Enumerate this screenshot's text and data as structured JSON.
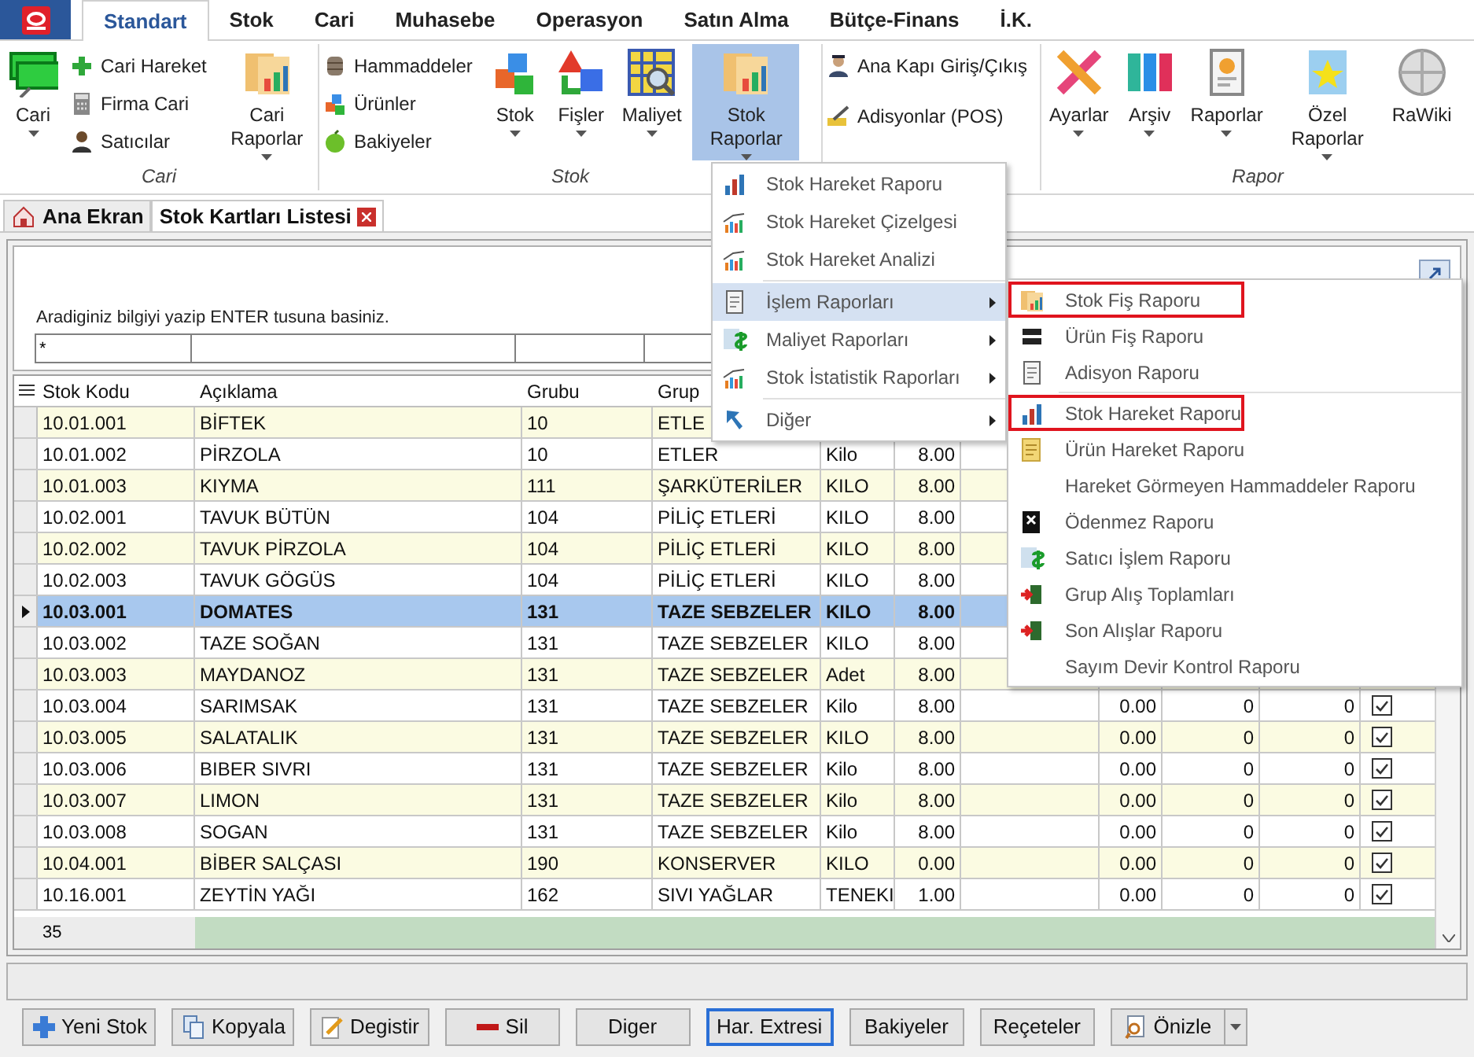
{
  "ribbon": {
    "tabs": [
      {
        "label": "Standart",
        "selected": true
      },
      {
        "label": "Stok",
        "selected": false
      },
      {
        "label": "Cari",
        "selected": false
      },
      {
        "label": "Muhasebe",
        "selected": false
      },
      {
        "label": "Operasyon",
        "selected": false
      },
      {
        "label": "Satın Alma",
        "selected": false
      },
      {
        "label": "Bütçe-Finans",
        "selected": false
      },
      {
        "label": "İ.K.",
        "selected": false
      }
    ],
    "groups": [
      {
        "label": "Cari",
        "items": [
          {
            "kind": "large",
            "label": "Cari",
            "dropdown": true,
            "selected": false
          },
          {
            "kind": "stack",
            "items": [
              {
                "label": "Cari Hareket"
              },
              {
                "label": "Firma Cari"
              },
              {
                "label": "Satıcılar"
              }
            ]
          },
          {
            "kind": "large",
            "label": "Cari Raporlar",
            "dropdown": true,
            "selected": false
          }
        ]
      },
      {
        "label": "Stok",
        "items": [
          {
            "kind": "stack",
            "items": [
              {
                "label": "Hammaddeler"
              },
              {
                "label": "Ürünler"
              },
              {
                "label": "Bakiyeler"
              }
            ]
          },
          {
            "kind": "large",
            "label": "Stok",
            "dropdown": true,
            "selected": false
          },
          {
            "kind": "large",
            "label": "Fişler",
            "dropdown": true,
            "selected": false
          },
          {
            "kind": "large",
            "label": "Maliyet",
            "dropdown": true,
            "selected": false
          },
          {
            "kind": "large",
            "label": "Stok Raporlar",
            "dropdown": true,
            "selected": true
          }
        ]
      },
      {
        "items": [
          {
            "kind": "stack",
            "items": [
              {
                "label": "Ana Kapı Giriş/Çıkış"
              },
              {
                "label": "Adisyonlar (POS)"
              }
            ]
          }
        ]
      },
      {
        "label": "Rapor",
        "items": [
          {
            "kind": "large",
            "label": "Ayarlar",
            "dropdown": true,
            "selected": false
          },
          {
            "kind": "large",
            "label": "Arşiv",
            "dropdown": true,
            "selected": false
          },
          {
            "kind": "large",
            "label": "Raporlar",
            "dropdown": true,
            "selected": false
          },
          {
            "kind": "large",
            "label": "Özel Raporlar",
            "dropdown": true,
            "selected": false
          },
          {
            "kind": "large",
            "label": "RaWiki",
            "dropdown": false,
            "selected": false
          }
        ]
      }
    ]
  },
  "document_tabs": [
    {
      "label": "Ana Ekran",
      "selected": false,
      "closable": false
    },
    {
      "label": "Stok Kartları Listesi",
      "selected": true,
      "closable": true
    }
  ],
  "filter": {
    "hint": "Aradiginiz bilgiyi yazip ENTER tusuna basiniz.",
    "fields": [
      "*"
    ]
  },
  "grid": {
    "columns": [
      "Stok Kodu",
      "Açıklama",
      "Grubu",
      "Grup"
    ],
    "rows": [
      {
        "selected": false,
        "stock_code": "10.01.001",
        "description": "BİFTEK",
        "group_code": "10",
        "group_name": "ETLE"
      },
      {
        "selected": false,
        "stock_code": "10.01.002",
        "description": "PİRZOLA",
        "group_code": "10",
        "group_name": "ETLER",
        "unit": "Kilo",
        "quantity": "8.00"
      },
      {
        "selected": false,
        "stock_code": "10.01.003",
        "description": "KIYMA",
        "group_code": "111",
        "group_name": "ŞARKÜTERİLER",
        "unit": "KILO",
        "quantity": "8.00"
      },
      {
        "selected": false,
        "stock_code": "10.02.001",
        "description": "TAVUK BÜTÜN",
        "group_code": "104",
        "group_name": "PİLİÇ ETLERİ",
        "unit": "KILO",
        "quantity": "8.00"
      },
      {
        "selected": false,
        "stock_code": "10.02.002",
        "description": "TAVUK PİRZOLA",
        "group_code": "104",
        "group_name": "PİLİÇ ETLERİ",
        "unit": "KILO",
        "quantity": "8.00"
      },
      {
        "selected": false,
        "stock_code": "10.02.003",
        "description": "TAVUK GÖGÜS",
        "group_code": "104",
        "group_name": "PİLİÇ ETLERİ",
        "unit": "KILO",
        "quantity": "8.00"
      },
      {
        "selected": true,
        "stock_code": "10.03.001",
        "description": "DOMATES",
        "group_code": "131",
        "group_name": "TAZE SEBZELER",
        "unit": "KILO",
        "quantity": "8.00"
      },
      {
        "selected": false,
        "stock_code": "10.03.002",
        "description": "TAZE SOĞAN",
        "group_code": "131",
        "group_name": "TAZE SEBZELER",
        "unit": "KILO",
        "quantity": "8.00"
      },
      {
        "selected": false,
        "stock_code": "10.03.003",
        "description": "MAYDANOZ",
        "group_code": "131",
        "group_name": "TAZE SEBZELER",
        "unit": "Adet",
        "quantity": "8.00"
      },
      {
        "selected": false,
        "stock_code": "10.03.004",
        "description": "SARIMSAK",
        "group_code": "131",
        "group_name": "TAZE SEBZELER",
        "unit": "Kilo",
        "quantity": "8.00",
        "column_8": "0.00",
        "column_9": "0",
        "column_10": "0",
        "checked": true
      },
      {
        "selected": false,
        "stock_code": "10.03.005",
        "description": "SALATALIK",
        "group_code": "131",
        "group_name": "TAZE SEBZELER",
        "unit": "KILO",
        "quantity": "8.00",
        "column_8": "0.00",
        "column_9": "0",
        "column_10": "0",
        "checked": true
      },
      {
        "selected": false,
        "stock_code": "10.03.006",
        "description": "BIBER SIVRI",
        "group_code": "131",
        "group_name": "TAZE SEBZELER",
        "unit": "Kilo",
        "quantity": "8.00",
        "column_8": "0.00",
        "column_9": "0",
        "column_10": "0",
        "checked": true
      },
      {
        "selected": false,
        "stock_code": "10.03.007",
        "description": "LIMON",
        "group_code": "131",
        "group_name": "TAZE SEBZELER",
        "unit": "Kilo",
        "quantity": "8.00",
        "column_8": "0.00",
        "column_9": "0",
        "column_10": "0",
        "checked": true
      },
      {
        "selected": false,
        "stock_code": "10.03.008",
        "description": "SOGAN",
        "group_code": "131",
        "group_name": "TAZE SEBZELER",
        "unit": "Kilo",
        "quantity": "8.00",
        "column_8": "0.00",
        "column_9": "0",
        "column_10": "0",
        "checked": true
      },
      {
        "selected": false,
        "stock_code": "10.04.001",
        "description": "BİBER SALÇASI",
        "group_code": "190",
        "group_name": "KONSERVER",
        "unit": "KILO",
        "quantity": "0.00",
        "column_8": "0.00",
        "column_9": "0",
        "column_10": "0",
        "checked": true
      },
      {
        "selected": false,
        "stock_code": "10.16.001",
        "description": "ZEYTİN YAĞI",
        "group_code": "162",
        "group_name": "SIVI YAĞLAR",
        "unit": "TENEKI",
        "quantity": "1.00",
        "column_8": "0.00",
        "column_9": "0",
        "column_10": "0",
        "checked": true
      }
    ],
    "footer_count": "35"
  },
  "menu": {
    "items": [
      {
        "kind": "item",
        "label": "Stok Hareket Raporu",
        "selected": false,
        "separator_before": false
      },
      {
        "kind": "item",
        "label": "Stok Hareket Çizelgesi",
        "selected": false,
        "separator_before": false
      },
      {
        "kind": "item",
        "label": "Stok Hareket Analizi",
        "selected": false,
        "separator_before": false
      },
      {
        "kind": "submenu",
        "label": "İşlem Raporları",
        "selected": true,
        "separator_before": true
      },
      {
        "kind": "submenu",
        "label": "Maliyet Raporları",
        "selected": false,
        "separator_before": false
      },
      {
        "kind": "submenu",
        "label": "Stok İstatistik Raporları",
        "selected": false,
        "separator_before": false
      },
      {
        "kind": "submenu",
        "label": "Diğer",
        "selected": false,
        "separator_before": true
      }
    ]
  },
  "submenu": {
    "items": [
      {
        "label": "Stok Fiş Raporu",
        "highlighted": true,
        "separator_before": false
      },
      {
        "label": "Ürün Fiş Raporu",
        "highlighted": false,
        "separator_before": false
      },
      {
        "label": "Adisyon Raporu",
        "highlighted": false,
        "separator_before": false
      },
      {
        "label": "Stok Hareket Raporu",
        "highlighted": true,
        "separator_before": true
      },
      {
        "label": "Ürün Hareket Raporu",
        "highlighted": false,
        "separator_before": false
      },
      {
        "label": "Hareket Görmeyen Hammaddeler Raporu",
        "highlighted": false,
        "separator_before": false
      },
      {
        "label": "Ödenmez Raporu",
        "highlighted": false,
        "separator_before": false
      },
      {
        "label": "Satıcı İşlem Raporu",
        "highlighted": false,
        "separator_before": false
      },
      {
        "label": "Grup Alış Toplamları",
        "highlighted": false,
        "separator_before": false
      },
      {
        "label": "Son Alışlar Raporu",
        "highlighted": false,
        "separator_before": false
      },
      {
        "label": "Sayım Devir Kontrol Raporu",
        "highlighted": false,
        "separator_before": false
      }
    ]
  },
  "buttons": [
    {
      "label": "Yeni Stok",
      "focused": false,
      "dropdown": false
    },
    {
      "label": "Kopyala",
      "focused": false,
      "dropdown": false
    },
    {
      "label": "Degistir",
      "focused": false,
      "dropdown": false
    },
    {
      "label": "Sil",
      "focused": false,
      "dropdown": false
    },
    {
      "label": "Diger",
      "focused": false,
      "dropdown": false
    },
    {
      "label": "Har. Extresi",
      "focused": true,
      "dropdown": false
    },
    {
      "label": "Bakiyeler",
      "focused": false,
      "dropdown": false
    },
    {
      "label": "Reçeteler",
      "focused": false,
      "dropdown": false
    },
    {
      "label": "Önizle",
      "focused": false,
      "dropdown": true
    }
  ]
}
